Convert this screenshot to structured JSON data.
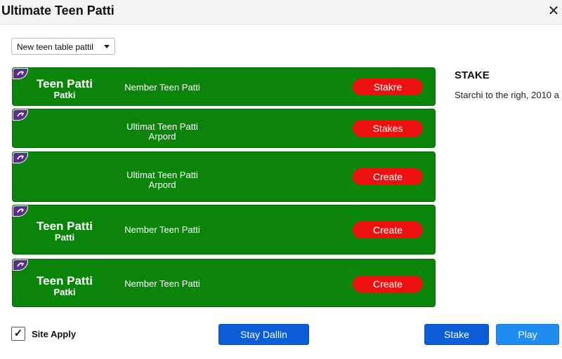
{
  "window": {
    "title": "Ultimate Teen Patti",
    "close_glyph": "✕"
  },
  "filter": {
    "selected": "New teen table pattil"
  },
  "rows": [
    {
      "logo_line1": "Teen Patti",
      "logo_line2": "Patki",
      "name_line1": "Nember Teen Patti",
      "name_line2": "",
      "button": "Stakre"
    },
    {
      "logo_line1": "",
      "logo_line2": "",
      "name_line1": "Ultimat Teen Patti",
      "name_line2": "Arpord",
      "button": "Stakes"
    },
    {
      "logo_line1": "",
      "logo_line2": "",
      "name_line1": "Ultimat Teen Patti",
      "name_line2": "Arpord",
      "button": "Create"
    },
    {
      "logo_line1": "Teen Patti",
      "logo_line2": "Patti",
      "name_line1": "Nember Teen Patti",
      "name_line2": "",
      "button": "Create"
    },
    {
      "logo_line1": "Teen Patti",
      "logo_line2": "Patki",
      "name_line1": "Nember Teen Patti",
      "name_line2": "",
      "button": "Create"
    }
  ],
  "side": {
    "title": "STAKE",
    "text": "Starchi to the righ, 2010 a"
  },
  "footer": {
    "checkbox_checked": true,
    "checkbox_mark": "✓",
    "checkbox_label": "Site Apply",
    "stay_button": "Stay Dallin",
    "stake_button": "Stake",
    "play_button": "Play"
  },
  "colors": {
    "row_bg": "#0a850a",
    "row_button": "#ee1010",
    "badge": "#5a2f8a",
    "primary_blue": "#0b5ed7",
    "light_blue": "#1e8cf0"
  },
  "icons": {
    "row_badge": "swirl-icon",
    "dropdown": "caret-down-icon",
    "close": "close-icon"
  }
}
